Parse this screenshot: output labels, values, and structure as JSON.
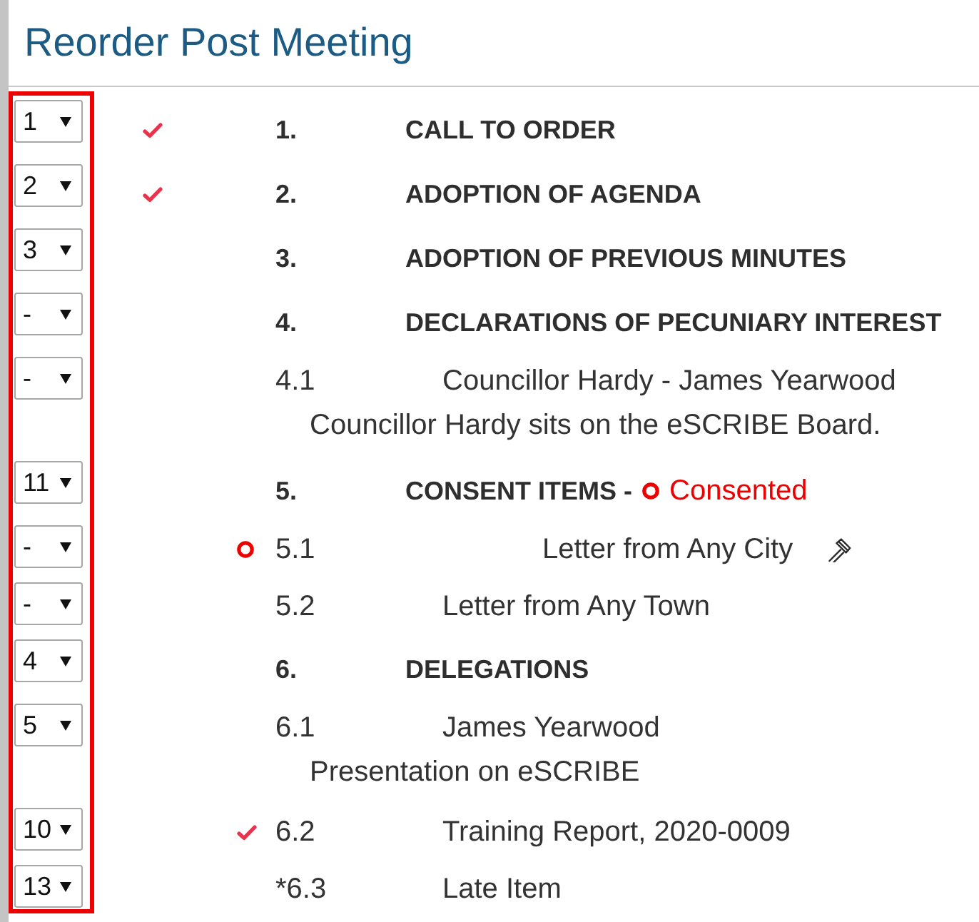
{
  "title": "Reorder Post Meeting",
  "sections": [
    {
      "order": "1",
      "completed": true,
      "consented": false,
      "number": "1.",
      "title": "CALL TO ORDER"
    },
    {
      "order": "2",
      "completed": true,
      "consented": false,
      "number": "2.",
      "title": "ADOPTION OF AGENDA"
    },
    {
      "order": "3",
      "completed": false,
      "consented": false,
      "number": "3.",
      "title": "ADOPTION OF PREVIOUS MINUTES"
    },
    {
      "order": "-",
      "completed": false,
      "consented": false,
      "number": "4.",
      "title": "DECLARATIONS OF PECUNIARY INTEREST",
      "children": [
        {
          "order": "-",
          "completed": false,
          "consented": false,
          "motion": false,
          "number": "4.1",
          "title": "Councillor Hardy - James Yearwood",
          "description": "Councillor Hardy sits on the eSCRIBE Board."
        }
      ]
    },
    {
      "order": "11",
      "completed": false,
      "consented": true,
      "consent_label": "Consented",
      "number": "5.",
      "title": "CONSENT ITEMS -",
      "children": [
        {
          "order": "-",
          "completed": false,
          "consented": true,
          "motion": true,
          "number": "5.1",
          "title": "Letter from Any City"
        },
        {
          "order": "-",
          "completed": false,
          "consented": false,
          "motion": false,
          "number": "5.2",
          "title": "Letter from Any Town"
        }
      ]
    },
    {
      "order": "4",
      "completed": false,
      "consented": false,
      "number": "6.",
      "title": "DELEGATIONS",
      "children": [
        {
          "order": "5",
          "completed": false,
          "consented": false,
          "motion": false,
          "number": "6.1",
          "title": "James Yearwood",
          "description": "Presentation on eSCRIBE"
        },
        {
          "order": "10",
          "completed": true,
          "consented": false,
          "motion": false,
          "number": "6.2",
          "title": "Training Report, 2020-0009"
        },
        {
          "order": "13",
          "completed": false,
          "consented": false,
          "motion": false,
          "number": "*6.3",
          "title": "Late Item"
        }
      ]
    }
  ]
}
